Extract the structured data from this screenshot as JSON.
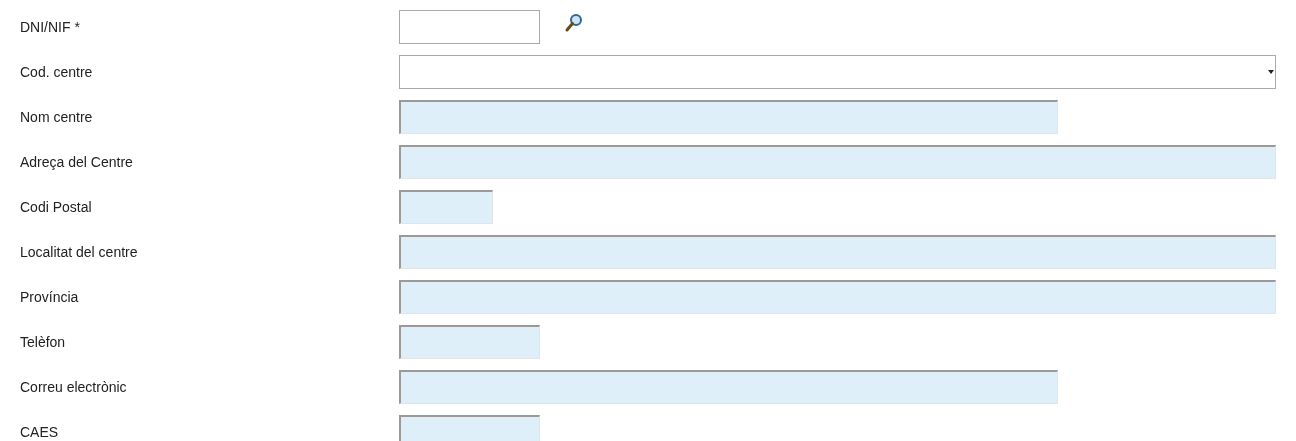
{
  "fields": [
    {
      "label": "DNI/NIF *",
      "kind": "lookup"
    },
    {
      "label": "Cod. centre",
      "kind": "select"
    },
    {
      "label": "Nom centre",
      "kind": "readonly"
    },
    {
      "label": "Adreça del Centre",
      "kind": "readonly"
    },
    {
      "label": "Codi Postal",
      "kind": "readonly"
    },
    {
      "label": "Localitat del centre",
      "kind": "readonly"
    },
    {
      "label": "Província",
      "kind": "readonly"
    },
    {
      "label": "Telèfon",
      "kind": "readonly"
    },
    {
      "label": "Correu electrònic",
      "kind": "readonly"
    },
    {
      "label": "CAES",
      "kind": "readonly"
    }
  ]
}
